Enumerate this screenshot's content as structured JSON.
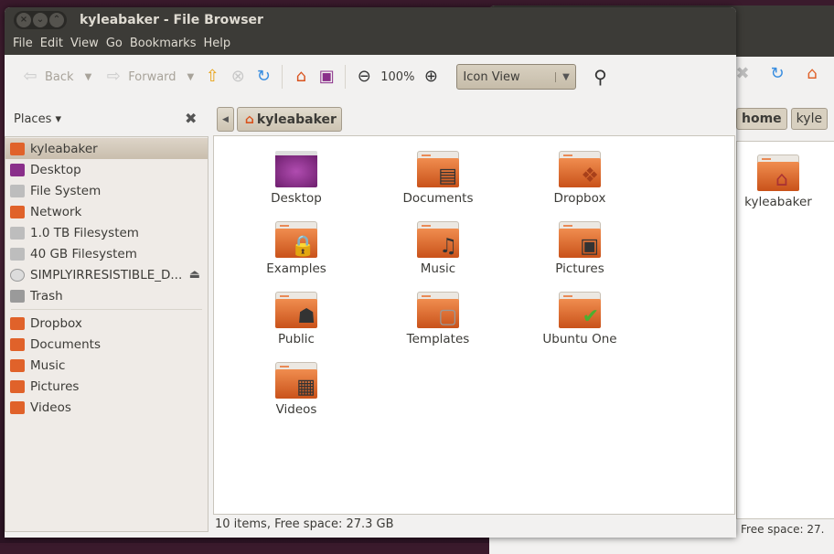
{
  "background_window": {
    "title": "home - File Browser",
    "breadcrumb": [
      "home",
      "kyle"
    ],
    "item": "kyleabaker",
    "status": "Free space: 27."
  },
  "window": {
    "title": "kyleabaker - File Browser"
  },
  "menu": [
    "File",
    "Edit",
    "View",
    "Go",
    "Bookmarks",
    "Help"
  ],
  "toolbar": {
    "back": "Back",
    "forward": "Forward",
    "zoom": "100%",
    "view_mode": "Icon View"
  },
  "sidebar": {
    "header": "Places",
    "items": [
      {
        "label": "kyleabaker",
        "icon": "home-folder-icon",
        "color": "#e0622a"
      },
      {
        "label": "Desktop",
        "icon": "desktop-icon",
        "color": "#8a2f8a"
      },
      {
        "label": "File System",
        "icon": "drive-icon",
        "color": "#bdbdbd"
      },
      {
        "label": "Network",
        "icon": "network-icon",
        "color": "#e0622a"
      },
      {
        "label": "1.0 TB Filesystem",
        "icon": "drive-icon",
        "color": "#bdbdbd"
      },
      {
        "label": "40 GB Filesystem",
        "icon": "drive-icon",
        "color": "#bdbdbd"
      },
      {
        "label": "SIMPLYIRRESISTIBLE_D...",
        "icon": "cd-icon",
        "color": "#dcdcdc"
      },
      {
        "label": "Trash",
        "icon": "trash-icon",
        "color": "#9a9a9a"
      }
    ],
    "bookmarks": [
      {
        "label": "Dropbox",
        "icon": "folder-icon",
        "color": "#e0622a"
      },
      {
        "label": "Documents",
        "icon": "documents-folder-icon",
        "color": "#e0622a"
      },
      {
        "label": "Music",
        "icon": "music-folder-icon",
        "color": "#e0622a"
      },
      {
        "label": "Pictures",
        "icon": "pictures-folder-icon",
        "color": "#e0622a"
      },
      {
        "label": "Videos",
        "icon": "videos-folder-icon",
        "color": "#e0622a"
      }
    ]
  },
  "location": {
    "current": "kyleabaker"
  },
  "files": [
    {
      "label": "Desktop",
      "glyph": ""
    },
    {
      "label": "Documents",
      "glyph": "▤"
    },
    {
      "label": "Dropbox",
      "glyph": "❖"
    },
    {
      "label": "Examples",
      "glyph": "🔒"
    },
    {
      "label": "Music",
      "glyph": "♫"
    },
    {
      "label": "Pictures",
      "glyph": "▣"
    },
    {
      "label": "Public",
      "glyph": "☗"
    },
    {
      "label": "Templates",
      "glyph": "▢"
    },
    {
      "label": "Ubuntu One",
      "glyph": "✔"
    },
    {
      "label": "Videos",
      "glyph": "▦"
    }
  ],
  "status": "10 items, Free space: 27.3 GB"
}
